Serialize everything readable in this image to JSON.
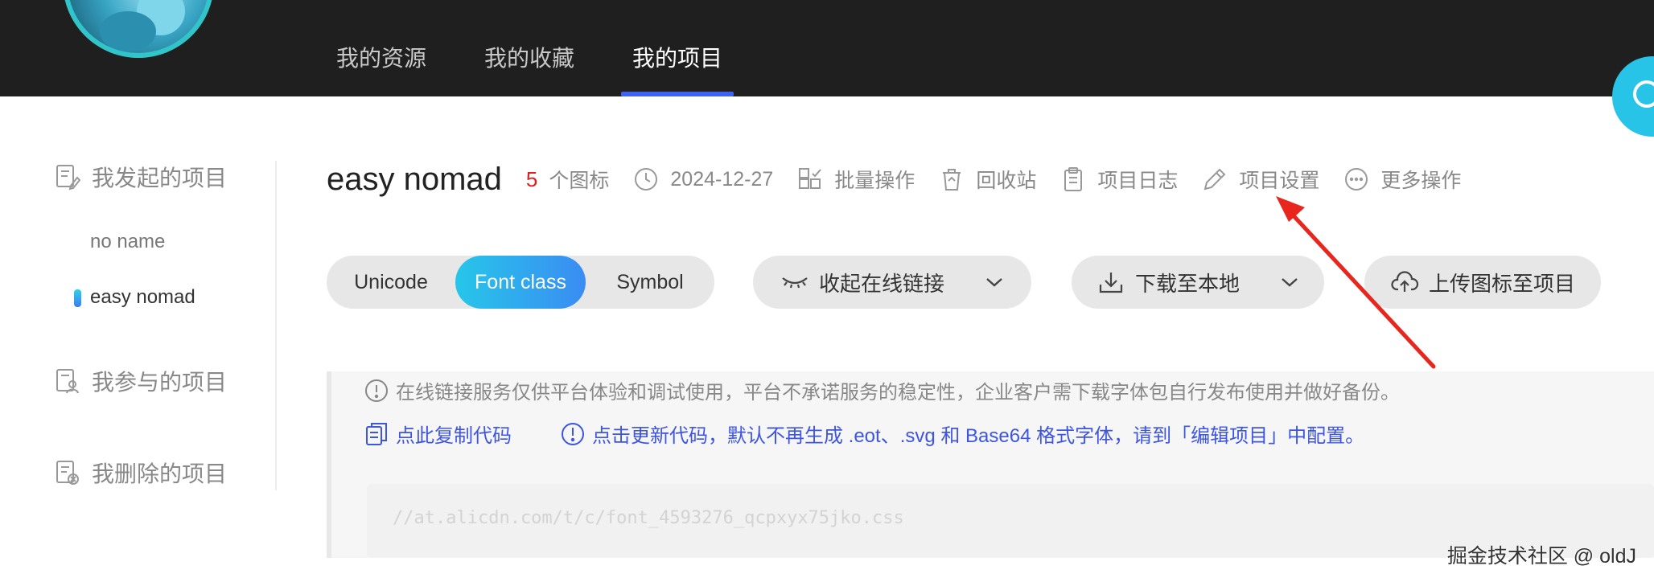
{
  "top_nav": {
    "items": [
      {
        "label": "我的资源"
      },
      {
        "label": "我的收藏"
      },
      {
        "label": "我的项目"
      }
    ],
    "active_index": 2,
    "active_color": "#3d63f0"
  },
  "sidebar": {
    "initiated_heading": "我发起的项目",
    "projects": [
      {
        "label": "no name"
      },
      {
        "label": "easy nomad"
      }
    ],
    "active_project": "easy nomad",
    "participated_heading": "我参与的项目",
    "deleted_heading": "我删除的项目"
  },
  "project": {
    "name": "easy nomad",
    "icon_count": "5",
    "icon_count_label": "个图标",
    "date": "2024-12-27",
    "actions": {
      "batch": "批量操作",
      "recycle": "回收站",
      "log": "项目日志",
      "settings": "项目设置",
      "more": "更多操作"
    }
  },
  "format_tabs": {
    "options": [
      "Unicode",
      "Font class",
      "Symbol"
    ],
    "selected": "Font class"
  },
  "buttons": {
    "collapse_link": "收起在线链接",
    "download": "下载至本地",
    "upload": "上传图标至项目"
  },
  "notice": {
    "warning": "在线链接服务仅供平台体验和调试使用，平台不承诺服务的稳定性，企业客户需下载字体包自行发布使用并做好备份。",
    "copy_code": "点此复制代码",
    "update_code": "点击更新代码，默认不再生成 .eot、.svg 和 Base64 格式字体，请到「编辑项目」中配置。",
    "code_url": "//at.alicdn.com/t/c/font_4593276_qcpxyx75jko.css"
  },
  "watermark": "掘金技术社区 @ oldJ",
  "colors": {
    "topbar_bg": "#1f1f1f",
    "accent_gradient_start": "#26c6e9",
    "accent_gradient_end": "#3a8cf3",
    "link_blue": "#3d55e0",
    "count_red": "#e02020",
    "annotation_arrow": "#e8261e"
  },
  "icons": [
    "doc-edit-icon",
    "doc-user-icon",
    "doc-delete-icon",
    "clock-icon",
    "grid-icon",
    "trash-icon",
    "clipboard-icon",
    "pencil-icon",
    "ellipsis-icon",
    "eye-closed-icon",
    "download-icon",
    "cloud-upload-icon",
    "chevron-down-icon",
    "info-icon",
    "copy-icon"
  ]
}
